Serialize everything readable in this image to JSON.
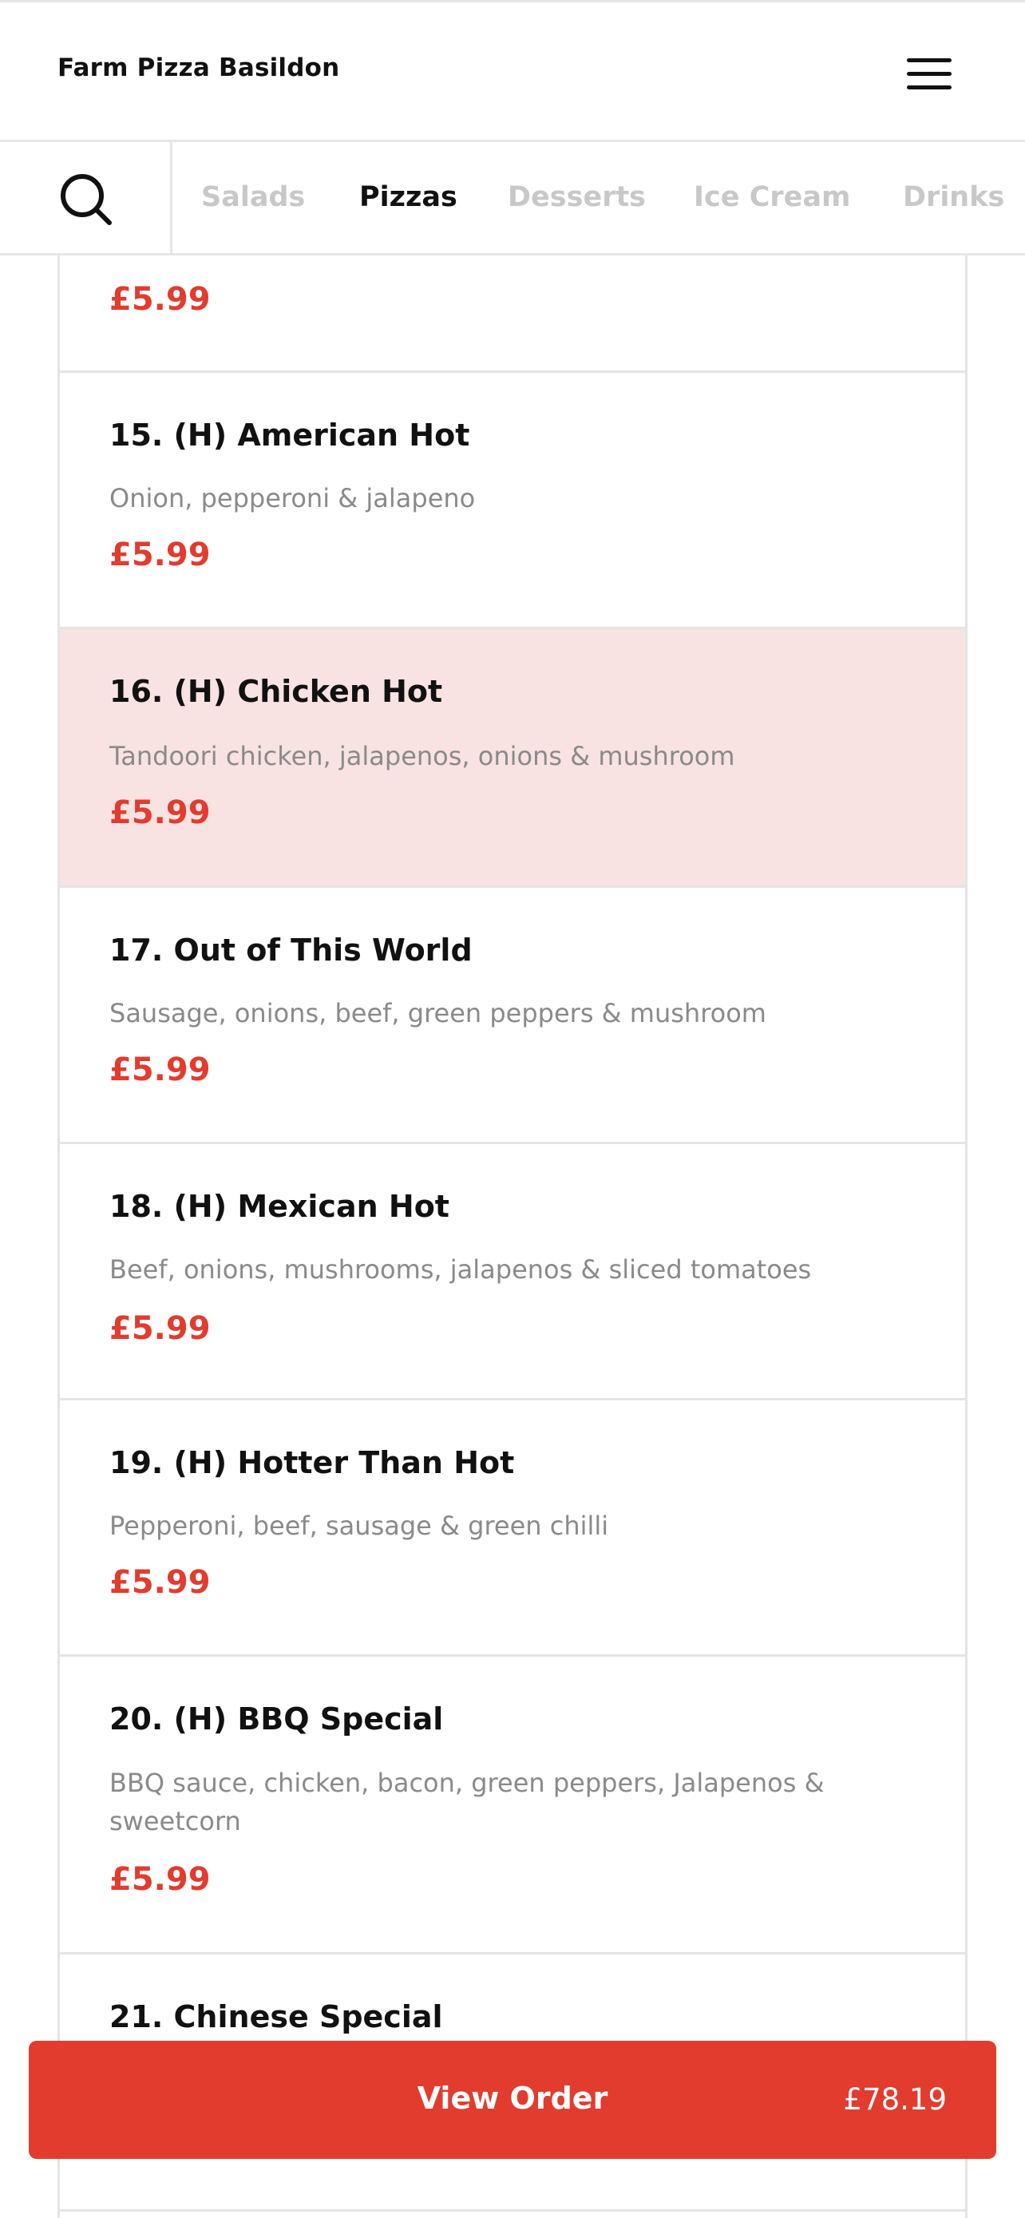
{
  "header": {
    "title": "Farm Pizza Basildon",
    "menu_icon": "hamburger-menu-icon"
  },
  "category_tabs": {
    "search_icon": "search-icon",
    "active": "Pizzas",
    "items": [
      {
        "label": "Salads"
      },
      {
        "label": "Pizzas"
      },
      {
        "label": "Desserts"
      },
      {
        "label": "Ice Cream"
      },
      {
        "label": "Drinks"
      }
    ]
  },
  "menu": {
    "partial_top_item": {
      "price": "£5.99"
    },
    "items": [
      {
        "name": "15. (H) American Hot",
        "description": "Onion, pepperoni & jalapeno",
        "price": "£5.99"
      },
      {
        "name": "16. (H) Chicken Hot",
        "description": "Tandoori chicken, jalapenos, onions & mushroom",
        "price": "£5.99"
      },
      {
        "name": "17. Out of This World",
        "description": "Sausage, onions, beef, green peppers & mushroom",
        "price": "£5.99"
      },
      {
        "name": "18. (H) Mexican Hot",
        "description": "Beef, onions, mushrooms, jalapenos & sliced tomatoes",
        "price": "£5.99"
      },
      {
        "name": "19. (H) Hotter Than Hot",
        "description": "Pepperoni, beef, sausage & green chilli",
        "price": "£5.99"
      },
      {
        "name": "20. (H) BBQ Special",
        "description": "BBQ sauce, chicken, bacon, green peppers, Jalapenos & sweetcorn",
        "price": "£5.99"
      },
      {
        "name": "21. Chinese Special"
      }
    ]
  },
  "order_bar": {
    "label": "View Order",
    "total": "£78.19"
  },
  "colors": {
    "accent": "#e23c2f",
    "highlight_row": "#f9e2e2",
    "muted_tab": "#c8c8c8",
    "border": "#e4e4e4"
  }
}
